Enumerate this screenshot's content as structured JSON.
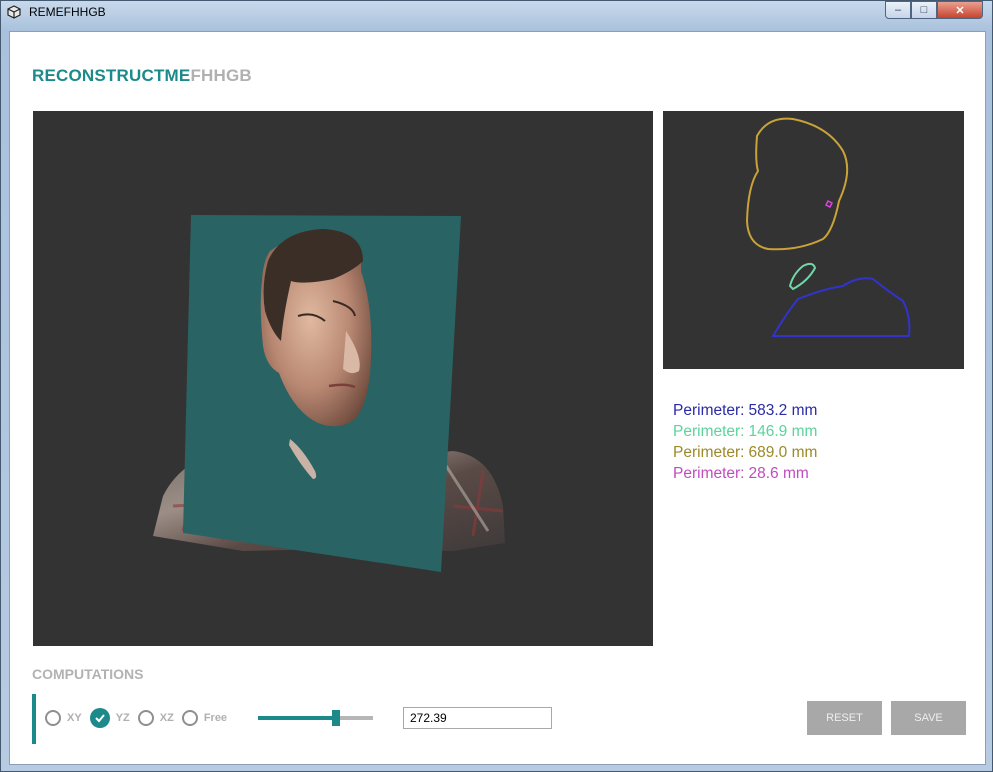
{
  "window": {
    "title": "REMEFHHGB",
    "controls": {
      "minimize": "–",
      "maximize": "□",
      "close": "✕"
    }
  },
  "brand": {
    "part1": "RECONSTRUCTME",
    "part2": "FHHGB",
    "color_primary": "#1c8a8a",
    "color_secondary": "#b0b0b0"
  },
  "viewport": {
    "background": "#333333",
    "plane_color": "#2a6363"
  },
  "contours": [
    {
      "label": "Perimeter:",
      "value": "583.2 mm",
      "color": "#2a2aa8",
      "stroke": "#3333cc"
    },
    {
      "label": "Perimeter:",
      "value": "146.9 mm",
      "color": "#5ad49c",
      "stroke": "#6ed8a8"
    },
    {
      "label": "Perimeter:",
      "value": "689.0 mm",
      "color": "#9c8a2a",
      "stroke": "#c9a23a"
    },
    {
      "label": "Perimeter:",
      "value": "28.6 mm",
      "color": "#c04cc0",
      "stroke": "#dd44dd"
    }
  ],
  "computations": {
    "title": "COMPUTATIONS",
    "options": [
      {
        "label": "XY",
        "checked": false
      },
      {
        "label": "YZ",
        "checked": true
      },
      {
        "label": "XZ",
        "checked": false
      },
      {
        "label": "Free",
        "checked": false
      }
    ],
    "slider_fraction": 0.68,
    "value": "272.39"
  },
  "buttons": {
    "reset": "RESET",
    "save": "SAVE"
  }
}
